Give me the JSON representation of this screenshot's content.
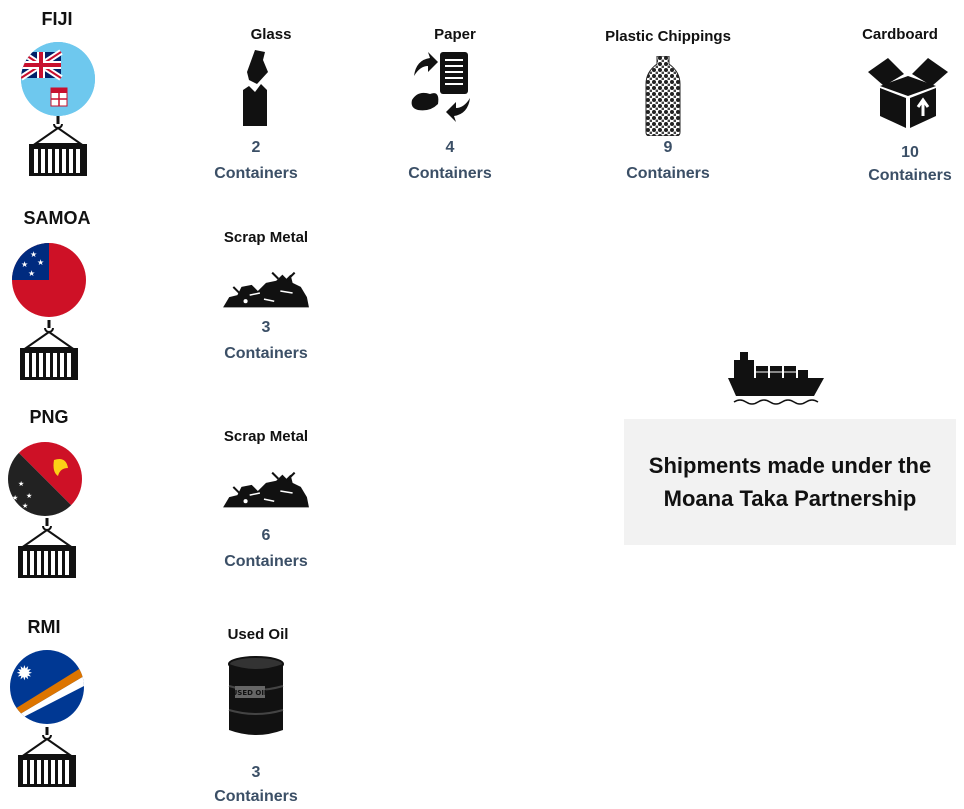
{
  "countries": [
    {
      "name": "FIJI",
      "items": [
        {
          "label": "Glass",
          "count": "2",
          "unit": "Containers"
        },
        {
          "label": "Paper",
          "count": "4",
          "unit": "Containers"
        },
        {
          "label": "Plastic Chippings",
          "count": "9",
          "unit": "Containers"
        },
        {
          "label": "Cardboard",
          "count": "10",
          "unit": "Containers"
        }
      ]
    },
    {
      "name": "SAMOA",
      "items": [
        {
          "label": "Scrap Metal",
          "count": "3",
          "unit": "Containers"
        }
      ]
    },
    {
      "name": "PNG",
      "items": [
        {
          "label": "Scrap Metal",
          "count": "6",
          "unit": "Containers"
        }
      ]
    },
    {
      "name": "RMI",
      "items": [
        {
          "label": "Used Oil",
          "count": "3",
          "unit": "Containers"
        }
      ]
    }
  ],
  "barrel_text": "USED OIL",
  "info": {
    "text": "Shipments made under the Moana Taka Partnership"
  },
  "colors": {
    "count_text": "#3b4f66",
    "box_bg": "#f2f2f2"
  },
  "icons": [
    "fiji-flag-icon",
    "samoa-flag-icon",
    "png-flag-icon",
    "rmi-flag-icon",
    "container-crane-icon",
    "bottle-icon",
    "paper-recycle-icon",
    "plastic-bottle-icon",
    "box-icon",
    "scrap-metal-icon",
    "oil-barrel-icon",
    "cargo-ship-icon"
  ]
}
